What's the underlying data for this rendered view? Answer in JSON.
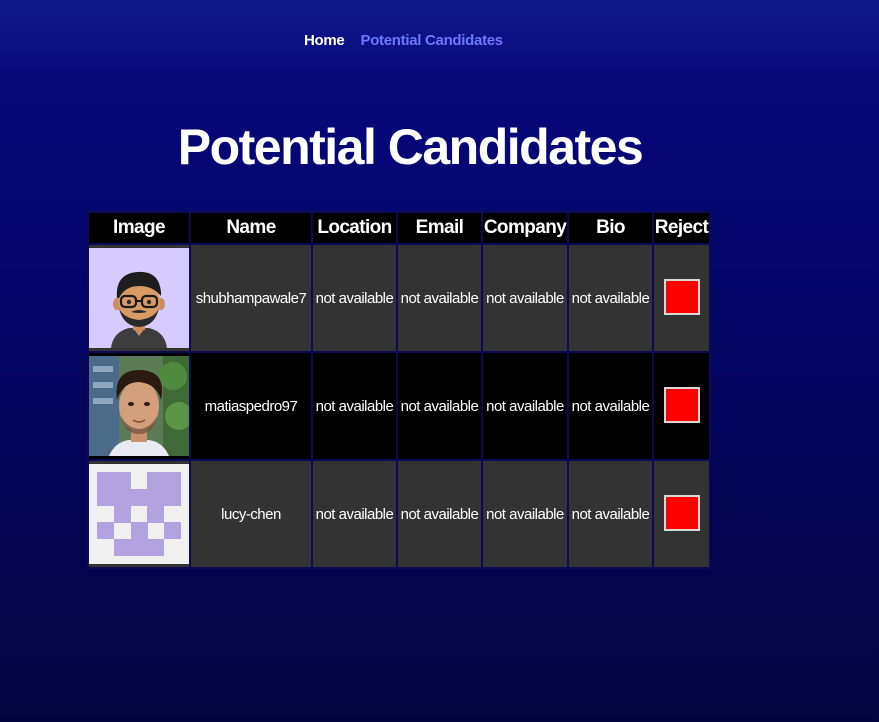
{
  "nav": {
    "home_label": "Home",
    "candidates_label": "Potential Candidates"
  },
  "page": {
    "title": "Potential Candidates"
  },
  "table": {
    "headers": [
      "Image",
      "Name",
      "Location",
      "Email",
      "Company",
      "Bio",
      "Reject"
    ],
    "rows": [
      {
        "name": "shubhampawale7",
        "location": "not available",
        "email": "not available",
        "company": "not available",
        "bio": "not available",
        "avatar": "cartoon-avatar-glasses"
      },
      {
        "name": "matiaspedro97",
        "location": "not available",
        "email": "not available",
        "company": "not available",
        "bio": "not available",
        "avatar": "photo-avatar"
      },
      {
        "name": "lucy-chen",
        "location": "not available",
        "email": "not available",
        "company": "not available",
        "bio": "not available",
        "avatar": "identicon-avatar"
      }
    ]
  },
  "colors": {
    "background_top": "#10188a",
    "background_bottom": "#03043f",
    "nav_active": "#6b78ff",
    "row_grey": "#333333",
    "row_black": "#000000",
    "reject_button": "#ff0000",
    "identicon": "#b3a2e0"
  }
}
